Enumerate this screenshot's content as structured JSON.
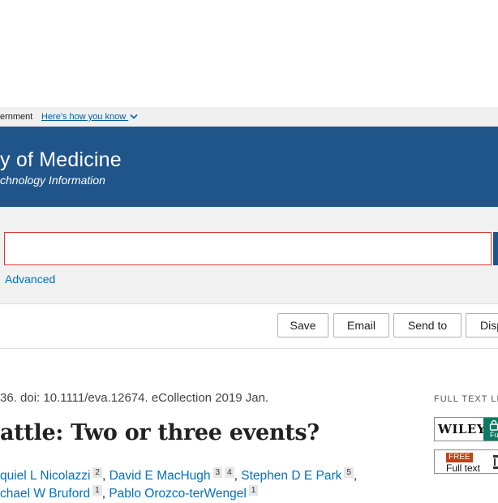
{
  "gov_banner": {
    "text": "ernment",
    "link": "Here's how you know"
  },
  "header": {
    "title": "y of Medicine",
    "subtitle": "chnology Information"
  },
  "search": {
    "query": "",
    "advanced_label": "Advanced"
  },
  "actions": {
    "save": "Save",
    "email": "Email",
    "send_to": "Send to",
    "display": "Disp"
  },
  "article": {
    "citation": "36. doi: 10.1111/eva.12674. eCollection 2019 Jan.",
    "title": "attle: Two or three events?",
    "authors_line1": [
      {
        "name": "quiel L Nicolazzi",
        "aff": "2"
      },
      {
        "name": "David E MacHugh",
        "aff": "3",
        "aff2": "4"
      },
      {
        "name": "Stephen D E Park",
        "aff": "5"
      }
    ],
    "authors_line2": [
      {
        "name": "chael W Bruford",
        "aff": "1"
      },
      {
        "name": "Pablo Orozco-terWengel",
        "aff": "1"
      }
    ]
  },
  "full_text_links": {
    "label": "FULL TEXT LI",
    "wiley": "WILEY",
    "wiley_badge": "Fu",
    "pmc_free": "FREE",
    "pmc_full_text": "Full text"
  },
  "colors": {
    "header_bg": "#20558a",
    "link": "#0071bc",
    "search_border": "#d83933",
    "wiley_green": "#0a7a60"
  }
}
